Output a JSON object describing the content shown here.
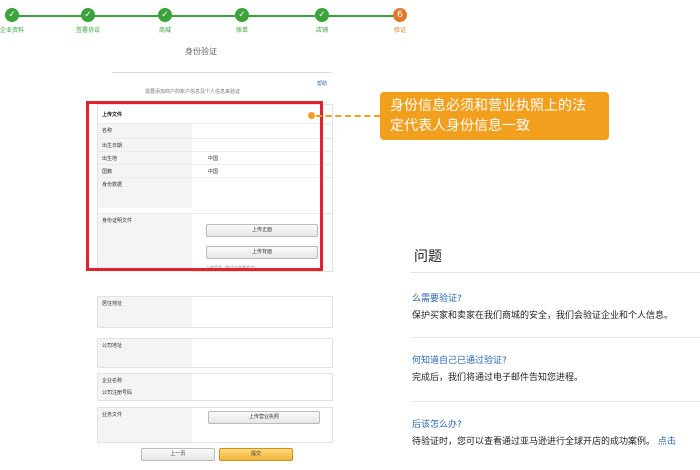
{
  "steps": [
    {
      "label": "企业资料",
      "state": "done"
    },
    {
      "label": "签署协议",
      "state": "done"
    },
    {
      "label": "商城",
      "state": "done"
    },
    {
      "label": "账单",
      "state": "done"
    },
    {
      "label": "店铺",
      "state": "done"
    },
    {
      "label": "验证",
      "state": "current",
      "number": "6"
    }
  ],
  "page": {
    "title": "身份验证",
    "subtitle": "需要添加商户的账户信息及个人信息来验证",
    "help_link": "帮助"
  },
  "identity_section": {
    "heading": "上传文件",
    "fields": [
      {
        "label": "名称",
        "value": ""
      },
      {
        "label": "出生日期",
        "value": ""
      },
      {
        "label": "出生地",
        "value": "中国"
      },
      {
        "label": "国籍",
        "value": "中国"
      },
      {
        "label": "身份数据",
        "value": ""
      }
    ],
    "id_docs_label": "身份证明文件",
    "upload_front": "上传正面",
    "upload_back": "上传背面",
    "upload_note": "上传背面（影印文件需签字）"
  },
  "address_section": {
    "label": "居住地址"
  },
  "company_address_section": {
    "label": "公司地址"
  },
  "company_info_section": {
    "name_label": "企业名称",
    "reg_label": "公司注册号码"
  },
  "business_docs_section": {
    "label": "业务文件",
    "upload_license": "上传营业执照"
  },
  "footer_buttons": {
    "prev": "上一页",
    "submit": "提交"
  },
  "callout": {
    "text": "身份信息必须和营业执照上的法定代表人身份信息一致",
    "color": "#f29f1e",
    "box_color": "#e3232b"
  },
  "faq": {
    "title": "问题",
    "items": [
      {
        "q": "么需要验证?",
        "a": "保护买家和卖家在我们商城的安全，我们会验证企业和个人信息。"
      },
      {
        "q": "何知道自己已通过验证?",
        "a": "完成后，我们将通过电子邮件告知您进程。"
      },
      {
        "q": "后该怎么办?",
        "a": "待验证时，您可以查看通过亚马逊进行全球开店的成功案例。",
        "link": "点击"
      }
    ]
  }
}
